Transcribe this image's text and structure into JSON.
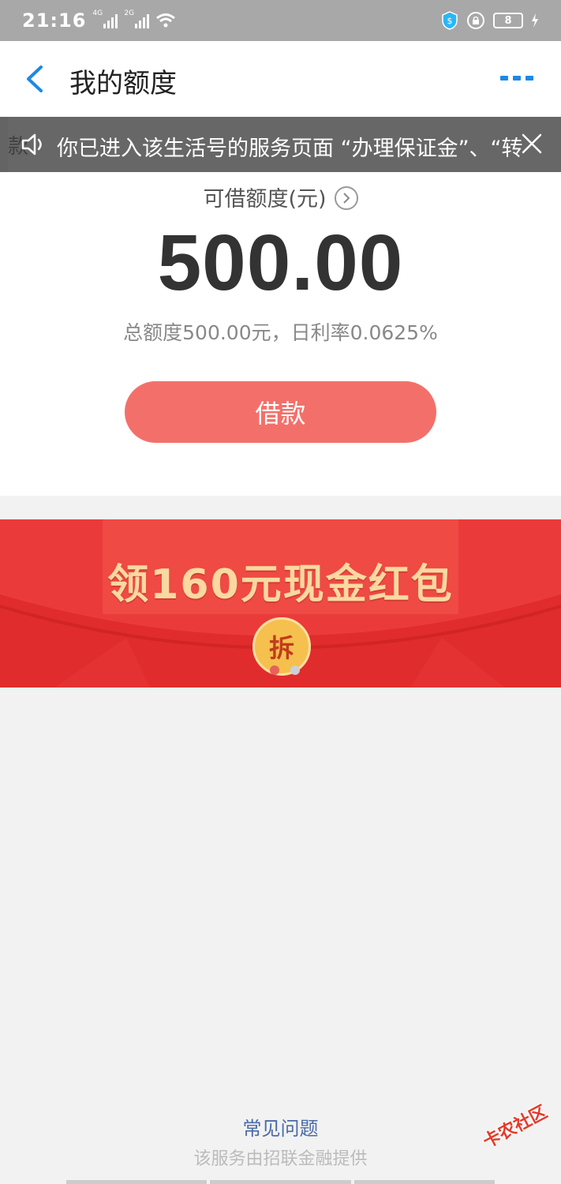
{
  "status_bar": {
    "time": "21:16",
    "signal1_tag": "4G",
    "signal2_tag": "2G",
    "battery": "8"
  },
  "header": {
    "title": "我的额度"
  },
  "notice": {
    "text": "你已进入该生活号的服务页面 “办理保证金”、“转",
    "underlay_text": "款"
  },
  "quota": {
    "label": "可借额度(元)",
    "amount": "500.00",
    "info": "总额度500.00元，日利率0.0625%",
    "borrow_label": "借款"
  },
  "promo": {
    "title": "领160元现金红包",
    "badge": "拆",
    "active_slide": 1,
    "slide_count": 2
  },
  "footer": {
    "faq": "常见问题",
    "provider": "该服务由招联金融提供"
  },
  "watermark": "卡农社区",
  "colors": {
    "accent_blue": "#1e88e5",
    "button": "#f3706a",
    "promo_bg": "#ea3b3a",
    "promo_text": "#f9d9a0"
  }
}
